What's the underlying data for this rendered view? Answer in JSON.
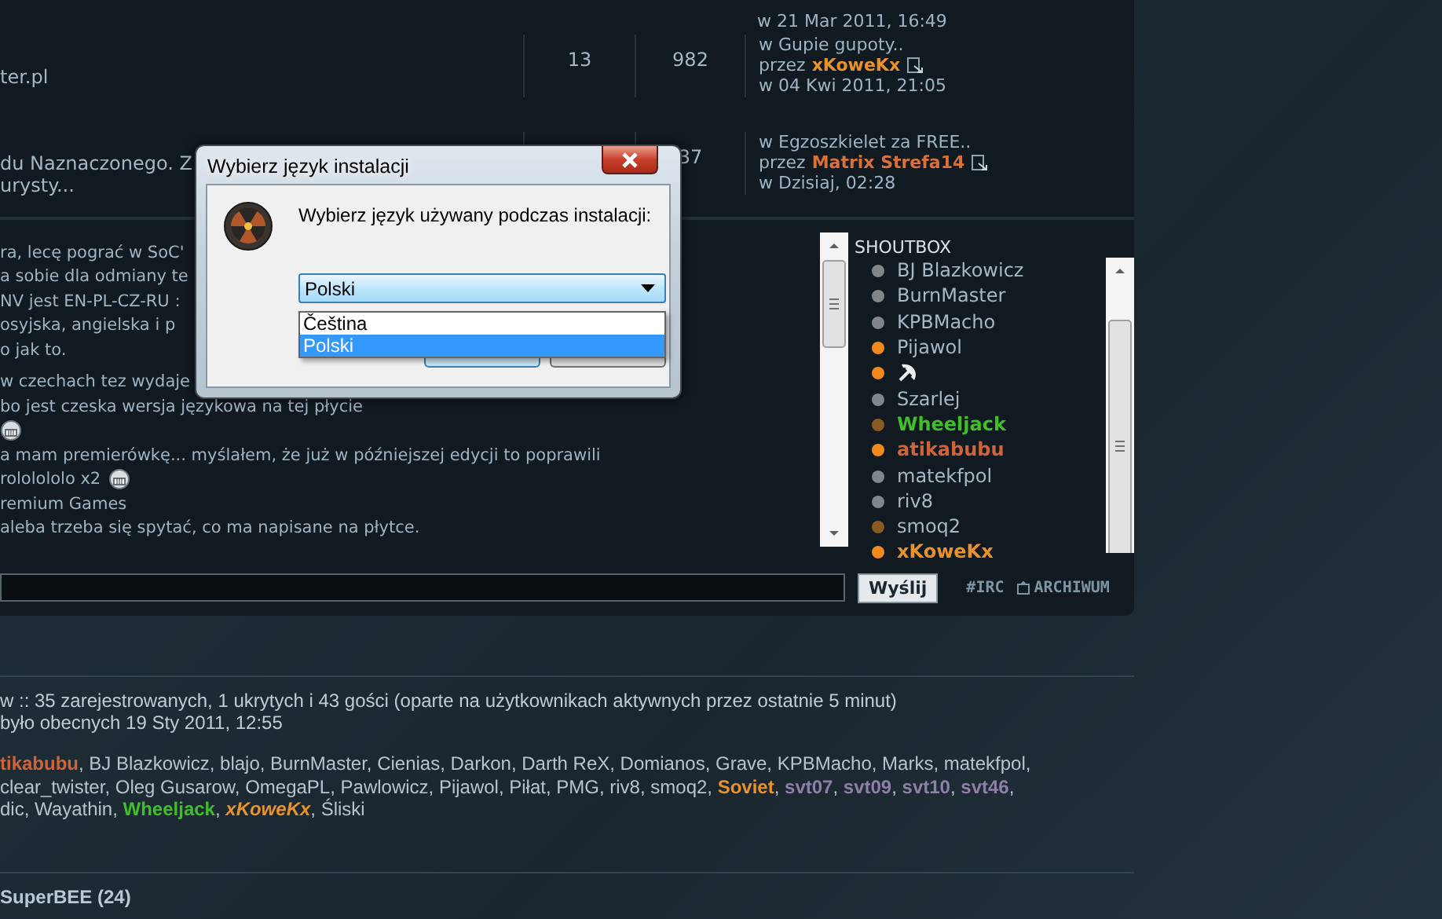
{
  "forum_rows": [
    {
      "last_post": {
        "date": "w 21 Mar 2011, 16:49"
      }
    },
    {
      "topic": [
        "ter.pl"
      ],
      "replies": "13",
      "views": "982",
      "last_post": {
        "topic": "w Gupie gupoty..",
        "prefix": "przez",
        "author": {
          "name": "xKoweKx",
          "color": "#e8922c"
        },
        "date": "w 04 Kwi 2011, 21:05"
      }
    },
    {
      "topic": [
        "du Naznaczonego. Z",
        "urysty..."
      ],
      "views": "37",
      "last_post": {
        "topic": "w Egzoszkielet za FREE..",
        "prefix": "przez",
        "author": {
          "name": "Matrix Strefa14",
          "color": "#d8703a"
        },
        "date": "w Dzisiaj, 02:28"
      }
    }
  ],
  "shoutbox": {
    "title": "SHOUTBOX",
    "messages": [
      {
        "text": "ra, lecę pograć w SoC'",
        "emoticon": false
      },
      {
        "text": "a sobie dla odmiany te",
        "emoticon": false
      },
      {
        "text": "NV jest EN-PL-CZ-RU :",
        "emoticon": false
      },
      {
        "text": "osyjska, angielska i p",
        "emoticon": false
      },
      {
        "text": "o jak to.",
        "emoticon": false
      },
      {
        "text": "w czechach tez wydaje",
        "emoticon": false
      },
      {
        "text": "bo jest czeska wersja językowa na tej płycie",
        "emoticon": false
      },
      {
        "emoticon": true
      },
      {
        "text": "a mam premierówkę... myślałem, że już w późniejszej edycji to poprawili",
        "emoticon": false
      },
      {
        "text": "rololololo x2",
        "emoticon": true
      },
      {
        "text": "remium Games",
        "emoticon": false
      },
      {
        "text": "aleba trzeba się spytać, co ma napisane na płytce.",
        "emoticon": false
      }
    ],
    "users": [
      {
        "kind": "name",
        "name": "BJ Blazkowicz",
        "status": {
          "color": "#80868a"
        }
      },
      {
        "kind": "name",
        "name": "BurnMaster",
        "status": {
          "color": "#80868a"
        }
      },
      {
        "kind": "name",
        "name": "KPBMacho",
        "status": {
          "color": "#80868a"
        }
      },
      {
        "kind": "name",
        "name": "Pijawol",
        "status": {
          "color": "#f08a1c"
        }
      },
      {
        "kind": "emblem",
        "status": {
          "color": "#f08a1c"
        }
      },
      {
        "kind": "name",
        "name": "Szarlej",
        "status": {
          "color": "#80868a"
        }
      },
      {
        "kind": "name",
        "name": "Wheeljack",
        "color": "#3fbf2a",
        "status": {
          "color": "#8a5a22"
        }
      },
      {
        "kind": "name",
        "name": "atikabubu",
        "color": "#d0633a",
        "status": {
          "color": "#f08a1c"
        }
      },
      {
        "kind": "name",
        "name": "matekfpol",
        "status": {
          "color": "#80868a"
        }
      },
      {
        "kind": "name",
        "name": "riv8",
        "status": {
          "color": "#80868a"
        }
      },
      {
        "kind": "name",
        "name": "smoq2",
        "status": {
          "color": "#8a5a22"
        }
      },
      {
        "kind": "name",
        "name": "xKoweKx",
        "color": "#e8922c",
        "status": {
          "color": "#f08a1c"
        }
      }
    ],
    "send_button": "Wyślij",
    "links": [
      {
        "label": "#IRC",
        "icon": false
      },
      {
        "label": "ARCHIWUM",
        "icon": true
      }
    ]
  },
  "online": {
    "summary": "w :: 35 zarejestrowanych, 1 ukrytych i 43 gości (oparte na użytkownikach aktywnych przez ostatnie 5 minut)",
    "record": " było obecnych 19 Sty 2011, 12:55",
    "user_lines": [
      [
        {
          "kind": "bold",
          "text": "tikabubu",
          "color": "#d0633a"
        },
        {
          "kind": "plain",
          "text": ", BJ Blazkowicz, blajo, BurnMaster, Cienias, Darkon, Darth ReX, Domianos, Grave, KPBMacho, Marks, matekfpol,"
        }
      ],
      [
        {
          "kind": "plain",
          "text": "clear_twister, Oleg Gusarow, OmegaPL, Pawlowicz, Pijawol, Piłat, PMG, riv8, smoq2, "
        },
        {
          "kind": "bold",
          "text": "Soviet",
          "color": "#e8922c"
        },
        {
          "kind": "plain",
          "text": ", "
        },
        {
          "kind": "bold",
          "text": "svt07",
          "color": "#8f7fa8"
        },
        {
          "kind": "plain",
          "text": ", "
        },
        {
          "kind": "bold",
          "text": "svt09",
          "color": "#8f7fa8"
        },
        {
          "kind": "plain",
          "text": ", "
        },
        {
          "kind": "bold",
          "text": "svt10",
          "color": "#8f7fa8"
        },
        {
          "kind": "plain",
          "text": ", "
        },
        {
          "kind": "bold",
          "text": "svt46",
          "color": "#8f7fa8"
        },
        {
          "kind": "plain",
          "text": ","
        }
      ],
      [
        {
          "kind": "plain",
          "text": "dic, Wayathin, "
        },
        {
          "kind": "bold",
          "text": "Wheeljack",
          "color": "#3fbf2a"
        },
        {
          "kind": "plain",
          "text": ", "
        },
        {
          "kind": "bold-italic",
          "text": "xKoweKx",
          "color": "#e8922c"
        },
        {
          "kind": "plain",
          "text": ", Śliski"
        }
      ]
    ],
    "birthday": "SuperBEE (24)"
  },
  "dialog": {
    "title": "Wybierz język instalacji",
    "message": "Wybierz język używany podczas instalacji:",
    "select_value": "Polski",
    "options": [
      {
        "label": "Čeština",
        "selected": false
      },
      {
        "label": "Polski",
        "selected": true
      }
    ],
    "buttons": [
      {
        "default": true
      },
      {
        "default": false
      }
    ]
  }
}
